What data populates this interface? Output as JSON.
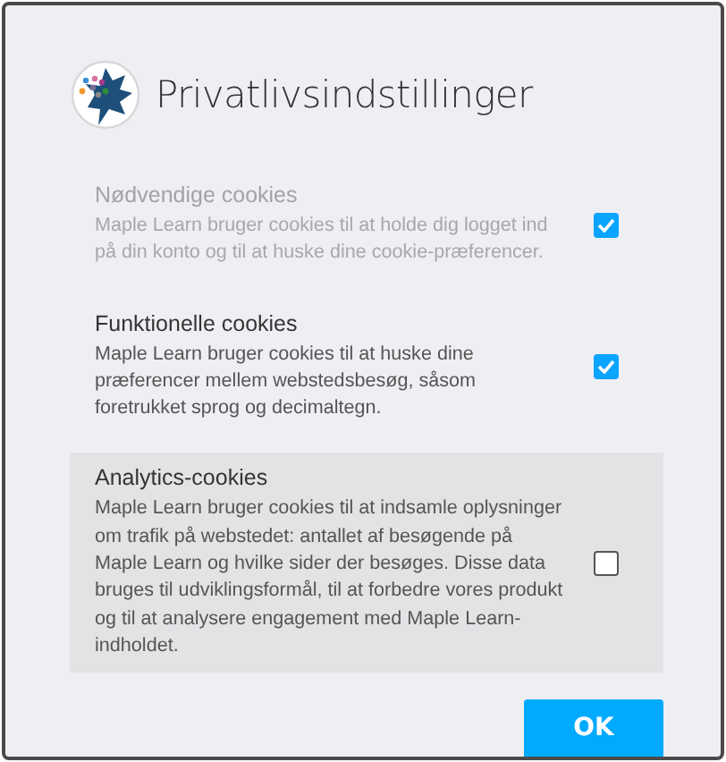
{
  "dialog": {
    "title": "Privatlivsindstillinger"
  },
  "sections": [
    {
      "title": "Nødvendige cookies",
      "text": "Maple Learn bruger cookies til at holde dig logget ind på din konto og til at huske dine cookie-præferencer.",
      "checked": true,
      "disabled": true,
      "highlighted": false
    },
    {
      "title": "Funktionelle cookies",
      "text": "Maple Learn bruger cookies til at huske dine præferencer mellem webstedsbesøg, såsom foretrukket sprog og decimaltegn.",
      "checked": true,
      "disabled": false,
      "highlighted": false
    },
    {
      "title": "Analytics-cookies",
      "text": "Maple Learn bruger cookies til at indsamle oplysninger om trafik på webstedet: antallet af besøgende på Maple Learn og hvilke sider der besøges. Disse data bruges til udviklingsformål, til at forbedre vores produkt og til at analysere engagement med Maple Learn-indholdet.",
      "checked": false,
      "disabled": false,
      "highlighted": true
    }
  ],
  "buttons": [
    {
      "label": "OK"
    }
  ]
}
